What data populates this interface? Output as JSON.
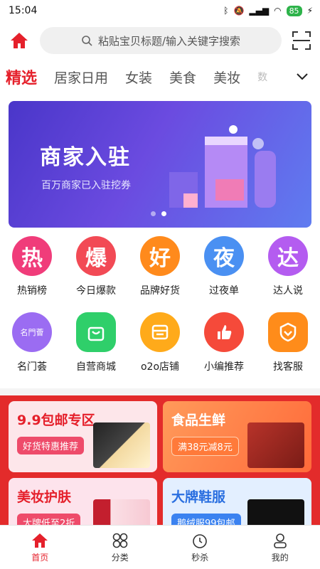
{
  "status": {
    "time": "15:04",
    "battery": "85"
  },
  "search": {
    "placeholder": "粘贴宝贝标题/输入关键字搜索"
  },
  "tabs": [
    {
      "label": "精选"
    },
    {
      "label": "居家日用"
    },
    {
      "label": "女装"
    },
    {
      "label": "美食"
    },
    {
      "label": "美妆"
    },
    {
      "label": "数"
    }
  ],
  "banner": {
    "title": "商家入驻",
    "subtitle": "百万商家已入驻挖券"
  },
  "grid": {
    "row1": [
      {
        "glyph": "热",
        "label": "热销榜",
        "color": "#f03c7a"
      },
      {
        "glyph": "爆",
        "label": "今日爆款",
        "color": "#f24a55"
      },
      {
        "glyph": "好",
        "label": "品牌好货",
        "color": "#ff8a1c"
      },
      {
        "glyph": "夜",
        "label": "过夜单",
        "color": "#4a90f2"
      },
      {
        "glyph": "达",
        "label": "达人说",
        "color": "#b45cf0"
      }
    ],
    "row2": [
      {
        "glyph": "名門薈",
        "label": "名门荟",
        "color": "#9b6cf2"
      },
      {
        "glyph": "",
        "label": "自营商城",
        "color": "#2fcf6a"
      },
      {
        "glyph": "",
        "label": "o2o店铺",
        "color": "#ffaa1a"
      },
      {
        "glyph": "",
        "label": "小编推荐",
        "color": "#f54a3a"
      },
      {
        "glyph": "",
        "label": "找客服",
        "color": "#ff8c1a"
      }
    ]
  },
  "promo": {
    "cards": [
      {
        "title": "9.9包邮专区",
        "tag": "好货特惠推荐",
        "title_color": "#e5202b",
        "tag_color": "#ee4b6a",
        "bg": "#fde6ea"
      },
      {
        "title": "食品生鲜",
        "tag": "满38元减8元",
        "title_color": "#ffffff",
        "tag_color": "#ff7a3a",
        "bg": "#ff8a4a"
      },
      {
        "title": "美妆护肤",
        "tag": "大牌低至2折",
        "title_color": "#e5202b",
        "tag_color": "#ee4b6a",
        "bg": "#fde3ec"
      },
      {
        "title": "大牌鞋服",
        "tag": "鹅绒服99包邮",
        "title_color": "#2a6fe0",
        "tag_color": "#3b82f0",
        "bg": "#e3efff"
      }
    ]
  },
  "nav": [
    {
      "label": "首页",
      "icon": "home-icon"
    },
    {
      "label": "分类",
      "icon": "category-icon"
    },
    {
      "label": "秒杀",
      "icon": "clock-icon"
    },
    {
      "label": "我的",
      "icon": "profile-icon"
    }
  ],
  "colors": {
    "accent": "#e5202b"
  }
}
